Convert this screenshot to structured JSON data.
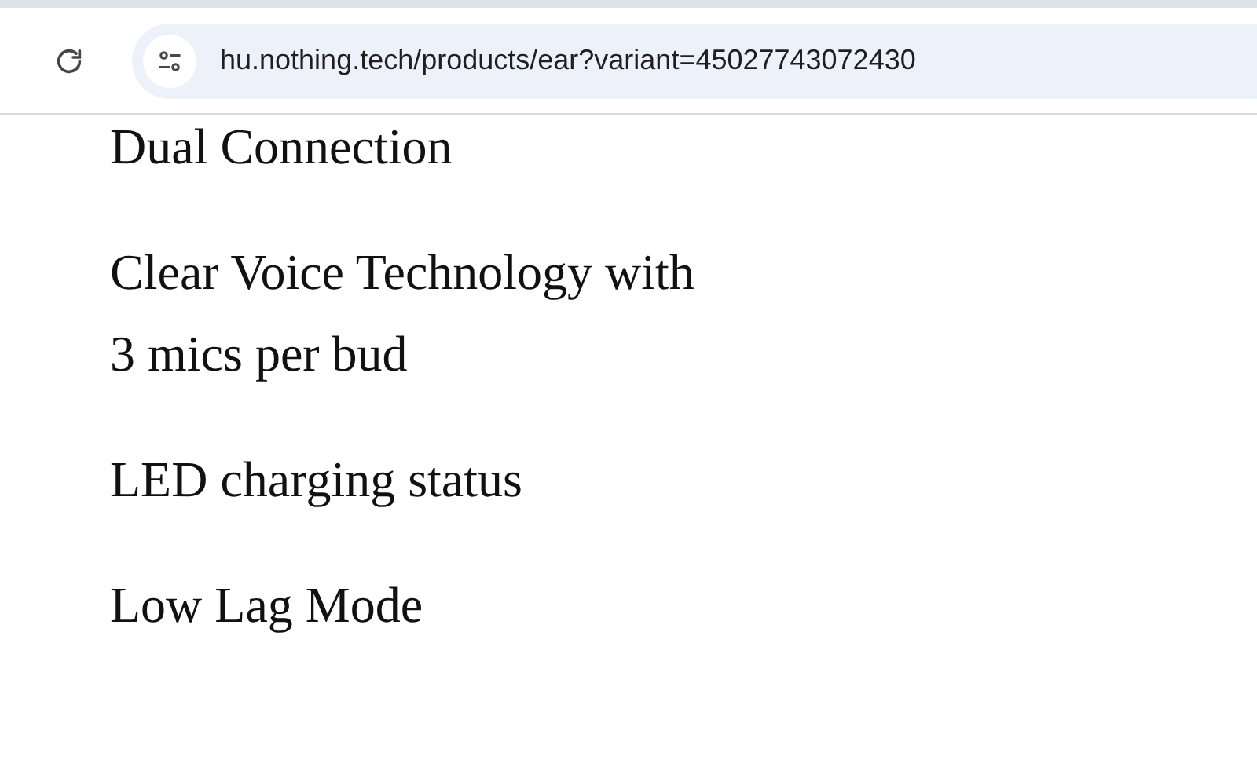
{
  "browser": {
    "url": "hu.nothing.tech/products/ear?variant=45027743072430"
  },
  "features": [
    "Dual Connection",
    "Clear Voice Technology with 3 mics per bud",
    "LED charging status",
    "Low Lag Mode"
  ]
}
